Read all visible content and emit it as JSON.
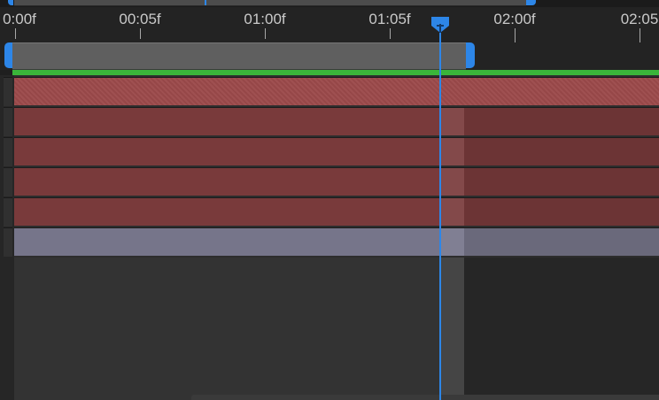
{
  "ruler": {
    "labels": [
      "0:00f",
      "00:05f",
      "01:00f",
      "01:05f",
      "02:00f",
      "02:05"
    ]
  },
  "tracks": [
    {
      "kind": "red",
      "selected": true
    },
    {
      "kind": "red",
      "selected": false
    },
    {
      "kind": "red",
      "selected": false
    },
    {
      "kind": "red",
      "selected": false
    },
    {
      "kind": "red",
      "selected": false
    },
    {
      "kind": "grey",
      "selected": false
    }
  ],
  "colors": {
    "accent": "#2d86e8",
    "work_area_indicator": "#3ab53a",
    "layer_red": "#793a3b",
    "layer_grey": "#76758a"
  },
  "icons": {
    "playhead": "current-time-indicator-icon"
  }
}
